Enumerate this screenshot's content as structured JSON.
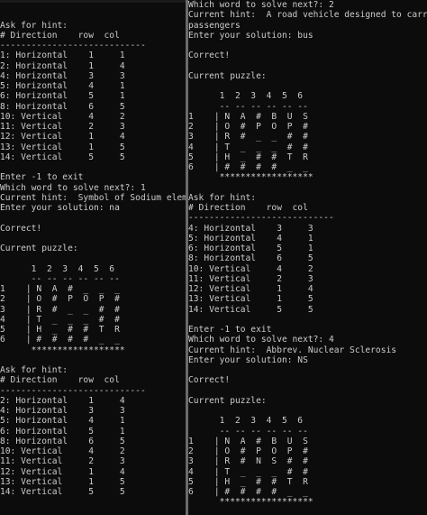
{
  "left_console": {
    "lines": [
      "Ask for hint:",
      "# Direction    row  col",
      "----------------------------",
      "1: Horizontal    1     1",
      "2: Horizontal    1     4",
      "4: Horizontal    3     3",
      "5: Horizontal    4     1",
      "6: Horizontal    5     1",
      "8: Horizontal    6     5",
      "10: Vertical     4     2",
      "11: Vertical     2     3",
      "12: Vertical     1     4",
      "13: Vertical     1     5",
      "14: Vertical     5     5",
      "",
      "Enter -1 to exit",
      "Which word to solve next?: 1",
      "Current hint:  Symbol of Sodium element",
      "Enter your solution: na",
      "",
      "Correct!",
      "",
      "Current puzzle:",
      "",
      "      1  2  3  4  5  6",
      "      -- -- -- -- -- --",
      "1    | N  A  #  _  _  _",
      "2    | O  #  P  O  P  #",
      "3    | R  #  _  _  #  #",
      "4    | T  _  _  _  #  #",
      "5    | H  _  #  #  T  R",
      "6    | #  #  #  #  _  _",
      "      ******************",
      "",
      "Ask for hint:",
      "# Direction    row  col",
      "----------------------------",
      "2: Horizontal    1     4",
      "4: Horizontal    3     3",
      "5: Horizontal    4     1",
      "6: Horizontal    5     1",
      "8: Horizontal    6     5",
      "10: Vertical     4     2",
      "11: Vertical     2     3",
      "12: Vertical     1     4",
      "13: Vertical     1     5",
      "14: Vertical     5     5",
      "",
      "",
      "Enter -1 to exit"
    ]
  },
  "right_console": {
    "lines": [
      "Which word to solve next?: 2",
      "Current hint:  A road vehicle designed to carry many",
      "passengers",
      "Enter your solution: bus",
      "",
      "Correct!",
      "",
      "Current puzzle:",
      "",
      "      1  2  3  4  5  6",
      "      -- -- -- -- -- --",
      "1    | N  A  #  B  U  S",
      "2    | O  #  P  O  P  #",
      "3    | R  #  _  _  #  #",
      "4    | T  _  _  _  #  #",
      "5    | H  _  #  #  T  R",
      "6    | #  #  #  #  _  _",
      "      ******************",
      "",
      "Ask for hint:",
      "# Direction    row  col",
      "----------------------------",
      "4: Horizontal    3     3",
      "5: Horizontal    4     1",
      "6: Horizontal    5     1",
      "8: Horizontal    6     5",
      "10: Vertical     4     2",
      "11: Vertical     2     3",
      "12: Vertical     1     4",
      "13: Vertical     1     5",
      "14: Vertical     5     5",
      "",
      "Enter -1 to exit",
      "Which word to solve next?: 4",
      "Current hint:  Abbrev. Nuclear Sclerosis",
      "Enter your solution: NS",
      "",
      "Correct!",
      "",
      "Current puzzle:",
      "",
      "      1  2  3  4  5  6",
      "      -- -- -- -- -- --",
      "1    | N  A  #  B  U  S",
      "2    | O  #  P  O  P  #",
      "3    | R  #  N  S  #  #",
      "4    | T  _  _  _  #  #",
      "5    | H  _  #  #  T  R",
      "6    | #  #  #  #  _  _",
      "      ******************"
    ]
  }
}
